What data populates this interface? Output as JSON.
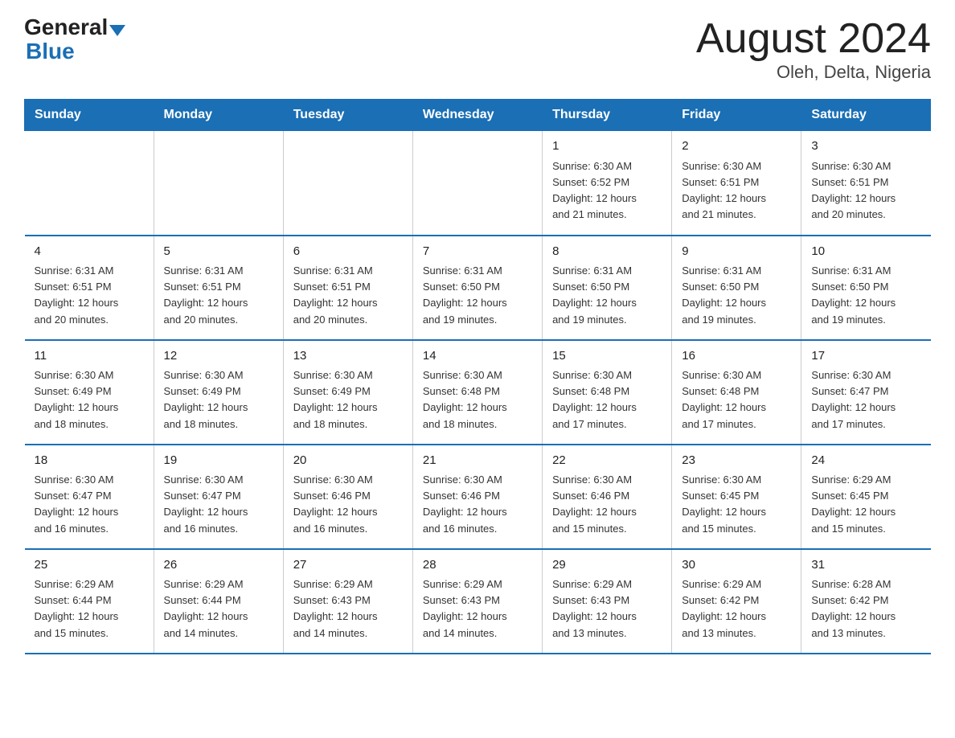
{
  "logo": {
    "general": "General",
    "blue": "Blue"
  },
  "title": "August 2024",
  "subtitle": "Oleh, Delta, Nigeria",
  "weekdays": [
    "Sunday",
    "Monday",
    "Tuesday",
    "Wednesday",
    "Thursday",
    "Friday",
    "Saturday"
  ],
  "weeks": [
    [
      {
        "day": "",
        "info": ""
      },
      {
        "day": "",
        "info": ""
      },
      {
        "day": "",
        "info": ""
      },
      {
        "day": "",
        "info": ""
      },
      {
        "day": "1",
        "info": "Sunrise: 6:30 AM\nSunset: 6:52 PM\nDaylight: 12 hours\nand 21 minutes."
      },
      {
        "day": "2",
        "info": "Sunrise: 6:30 AM\nSunset: 6:51 PM\nDaylight: 12 hours\nand 21 minutes."
      },
      {
        "day": "3",
        "info": "Sunrise: 6:30 AM\nSunset: 6:51 PM\nDaylight: 12 hours\nand 20 minutes."
      }
    ],
    [
      {
        "day": "4",
        "info": "Sunrise: 6:31 AM\nSunset: 6:51 PM\nDaylight: 12 hours\nand 20 minutes."
      },
      {
        "day": "5",
        "info": "Sunrise: 6:31 AM\nSunset: 6:51 PM\nDaylight: 12 hours\nand 20 minutes."
      },
      {
        "day": "6",
        "info": "Sunrise: 6:31 AM\nSunset: 6:51 PM\nDaylight: 12 hours\nand 20 minutes."
      },
      {
        "day": "7",
        "info": "Sunrise: 6:31 AM\nSunset: 6:50 PM\nDaylight: 12 hours\nand 19 minutes."
      },
      {
        "day": "8",
        "info": "Sunrise: 6:31 AM\nSunset: 6:50 PM\nDaylight: 12 hours\nand 19 minutes."
      },
      {
        "day": "9",
        "info": "Sunrise: 6:31 AM\nSunset: 6:50 PM\nDaylight: 12 hours\nand 19 minutes."
      },
      {
        "day": "10",
        "info": "Sunrise: 6:31 AM\nSunset: 6:50 PM\nDaylight: 12 hours\nand 19 minutes."
      }
    ],
    [
      {
        "day": "11",
        "info": "Sunrise: 6:30 AM\nSunset: 6:49 PM\nDaylight: 12 hours\nand 18 minutes."
      },
      {
        "day": "12",
        "info": "Sunrise: 6:30 AM\nSunset: 6:49 PM\nDaylight: 12 hours\nand 18 minutes."
      },
      {
        "day": "13",
        "info": "Sunrise: 6:30 AM\nSunset: 6:49 PM\nDaylight: 12 hours\nand 18 minutes."
      },
      {
        "day": "14",
        "info": "Sunrise: 6:30 AM\nSunset: 6:48 PM\nDaylight: 12 hours\nand 18 minutes."
      },
      {
        "day": "15",
        "info": "Sunrise: 6:30 AM\nSunset: 6:48 PM\nDaylight: 12 hours\nand 17 minutes."
      },
      {
        "day": "16",
        "info": "Sunrise: 6:30 AM\nSunset: 6:48 PM\nDaylight: 12 hours\nand 17 minutes."
      },
      {
        "day": "17",
        "info": "Sunrise: 6:30 AM\nSunset: 6:47 PM\nDaylight: 12 hours\nand 17 minutes."
      }
    ],
    [
      {
        "day": "18",
        "info": "Sunrise: 6:30 AM\nSunset: 6:47 PM\nDaylight: 12 hours\nand 16 minutes."
      },
      {
        "day": "19",
        "info": "Sunrise: 6:30 AM\nSunset: 6:47 PM\nDaylight: 12 hours\nand 16 minutes."
      },
      {
        "day": "20",
        "info": "Sunrise: 6:30 AM\nSunset: 6:46 PM\nDaylight: 12 hours\nand 16 minutes."
      },
      {
        "day": "21",
        "info": "Sunrise: 6:30 AM\nSunset: 6:46 PM\nDaylight: 12 hours\nand 16 minutes."
      },
      {
        "day": "22",
        "info": "Sunrise: 6:30 AM\nSunset: 6:46 PM\nDaylight: 12 hours\nand 15 minutes."
      },
      {
        "day": "23",
        "info": "Sunrise: 6:30 AM\nSunset: 6:45 PM\nDaylight: 12 hours\nand 15 minutes."
      },
      {
        "day": "24",
        "info": "Sunrise: 6:29 AM\nSunset: 6:45 PM\nDaylight: 12 hours\nand 15 minutes."
      }
    ],
    [
      {
        "day": "25",
        "info": "Sunrise: 6:29 AM\nSunset: 6:44 PM\nDaylight: 12 hours\nand 15 minutes."
      },
      {
        "day": "26",
        "info": "Sunrise: 6:29 AM\nSunset: 6:44 PM\nDaylight: 12 hours\nand 14 minutes."
      },
      {
        "day": "27",
        "info": "Sunrise: 6:29 AM\nSunset: 6:43 PM\nDaylight: 12 hours\nand 14 minutes."
      },
      {
        "day": "28",
        "info": "Sunrise: 6:29 AM\nSunset: 6:43 PM\nDaylight: 12 hours\nand 14 minutes."
      },
      {
        "day": "29",
        "info": "Sunrise: 6:29 AM\nSunset: 6:43 PM\nDaylight: 12 hours\nand 13 minutes."
      },
      {
        "day": "30",
        "info": "Sunrise: 6:29 AM\nSunset: 6:42 PM\nDaylight: 12 hours\nand 13 minutes."
      },
      {
        "day": "31",
        "info": "Sunrise: 6:28 AM\nSunset: 6:42 PM\nDaylight: 12 hours\nand 13 minutes."
      }
    ]
  ]
}
